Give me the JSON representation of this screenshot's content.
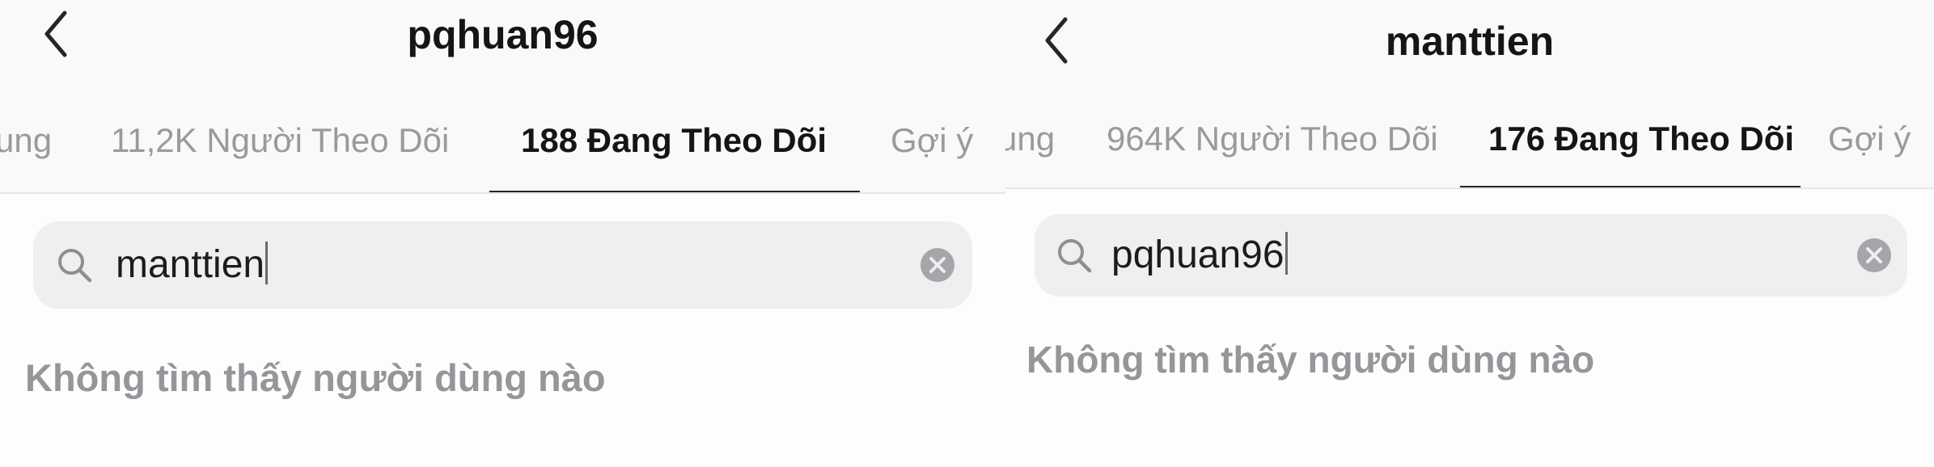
{
  "left": {
    "title": "pqhuan96",
    "tabs": [
      {
        "label": "ung",
        "active": false
      },
      {
        "label": "11,2K Người Theo Dõi",
        "active": false
      },
      {
        "label": "188 Đang Theo Dõi",
        "active": true
      },
      {
        "label": "Gợi ý",
        "active": false
      }
    ],
    "search": {
      "value": "manttien"
    },
    "empty_message": "Không tìm thấy người dùng nào"
  },
  "right": {
    "title": "manttien",
    "tabs": [
      {
        "label": "ung",
        "active": false
      },
      {
        "label": "964K Người Theo Dõi",
        "active": false
      },
      {
        "label": "176 Đang Theo Dõi",
        "active": true
      },
      {
        "label": "Gợi ý",
        "active": false
      }
    ],
    "search": {
      "value": "pqhuan96"
    },
    "empty_message": "Không tìm thấy người dùng nào"
  },
  "icons": {
    "back": "chevron-left-icon",
    "search": "search-icon",
    "clear": "clear-icon"
  },
  "colors": {
    "background": "#fdfdfd",
    "header_background": "#f9f9f9",
    "search_background": "#efefef",
    "active_text": "#151515",
    "inactive_text": "#9a9a9d",
    "empty_text": "#96969a"
  }
}
